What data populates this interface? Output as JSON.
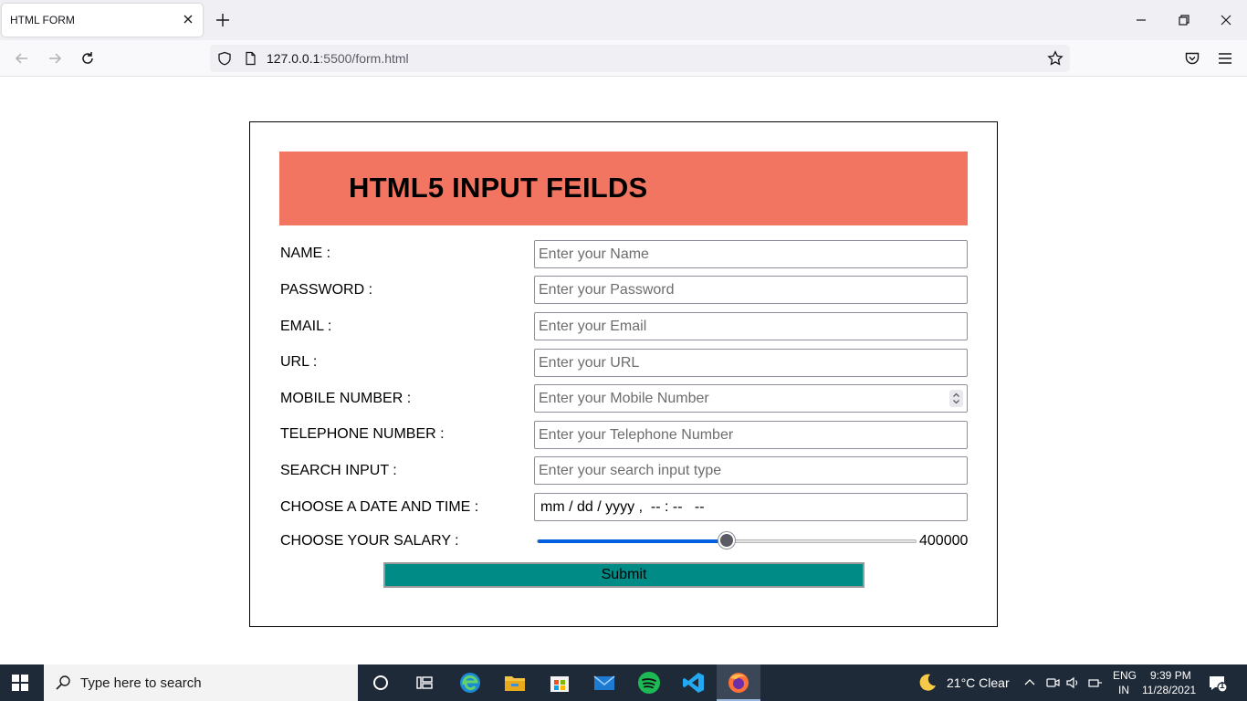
{
  "browser": {
    "tab_title": "HTML FORM",
    "url_host": "127.0.0.1",
    "url_path": ":5500/form.html"
  },
  "form": {
    "title": "HTML5 INPUT FEILDS",
    "header_color": "#f17560",
    "fields": {
      "name": {
        "label": "NAME :",
        "placeholder": "Enter your Name"
      },
      "password": {
        "label": "PASSWORD :",
        "placeholder": "Enter your Password"
      },
      "email": {
        "label": "EMAIL :",
        "placeholder": "Enter your Email"
      },
      "url": {
        "label": "URL :",
        "placeholder": "Enter your URL"
      },
      "mobile": {
        "label": "MOBILE NUMBER :",
        "placeholder": "Enter your Mobile Number"
      },
      "telephone": {
        "label": "TELEPHONE NUMBER :",
        "placeholder": "Enter your Telephone Number"
      },
      "search": {
        "label": "SEARCH INPUT :",
        "placeholder": "Enter your search input type"
      },
      "datetime": {
        "label": "CHOOSE A DATE AND TIME :",
        "value": "mm / dd / yyyy ,  -- : --   --"
      },
      "salary": {
        "label": "CHOOSE YOUR SALARY :",
        "value_text": "400000",
        "fraction": 0.5
      }
    },
    "submit_label": "Submit",
    "submit_color": "#008b87"
  },
  "taskbar": {
    "search_placeholder": "Type here to search",
    "weather": "21°C  Clear",
    "lang_top": "ENG",
    "lang_bottom": "IN",
    "time": "9:39 PM",
    "date": "11/28/2021",
    "notification_count": "1",
    "apps": [
      "cortana-icon",
      "task-view-icon",
      "edge-icon",
      "file-explorer-icon",
      "microsoft-store-icon",
      "mail-icon",
      "spotify-icon",
      "vscode-icon",
      "firefox-icon"
    ]
  }
}
